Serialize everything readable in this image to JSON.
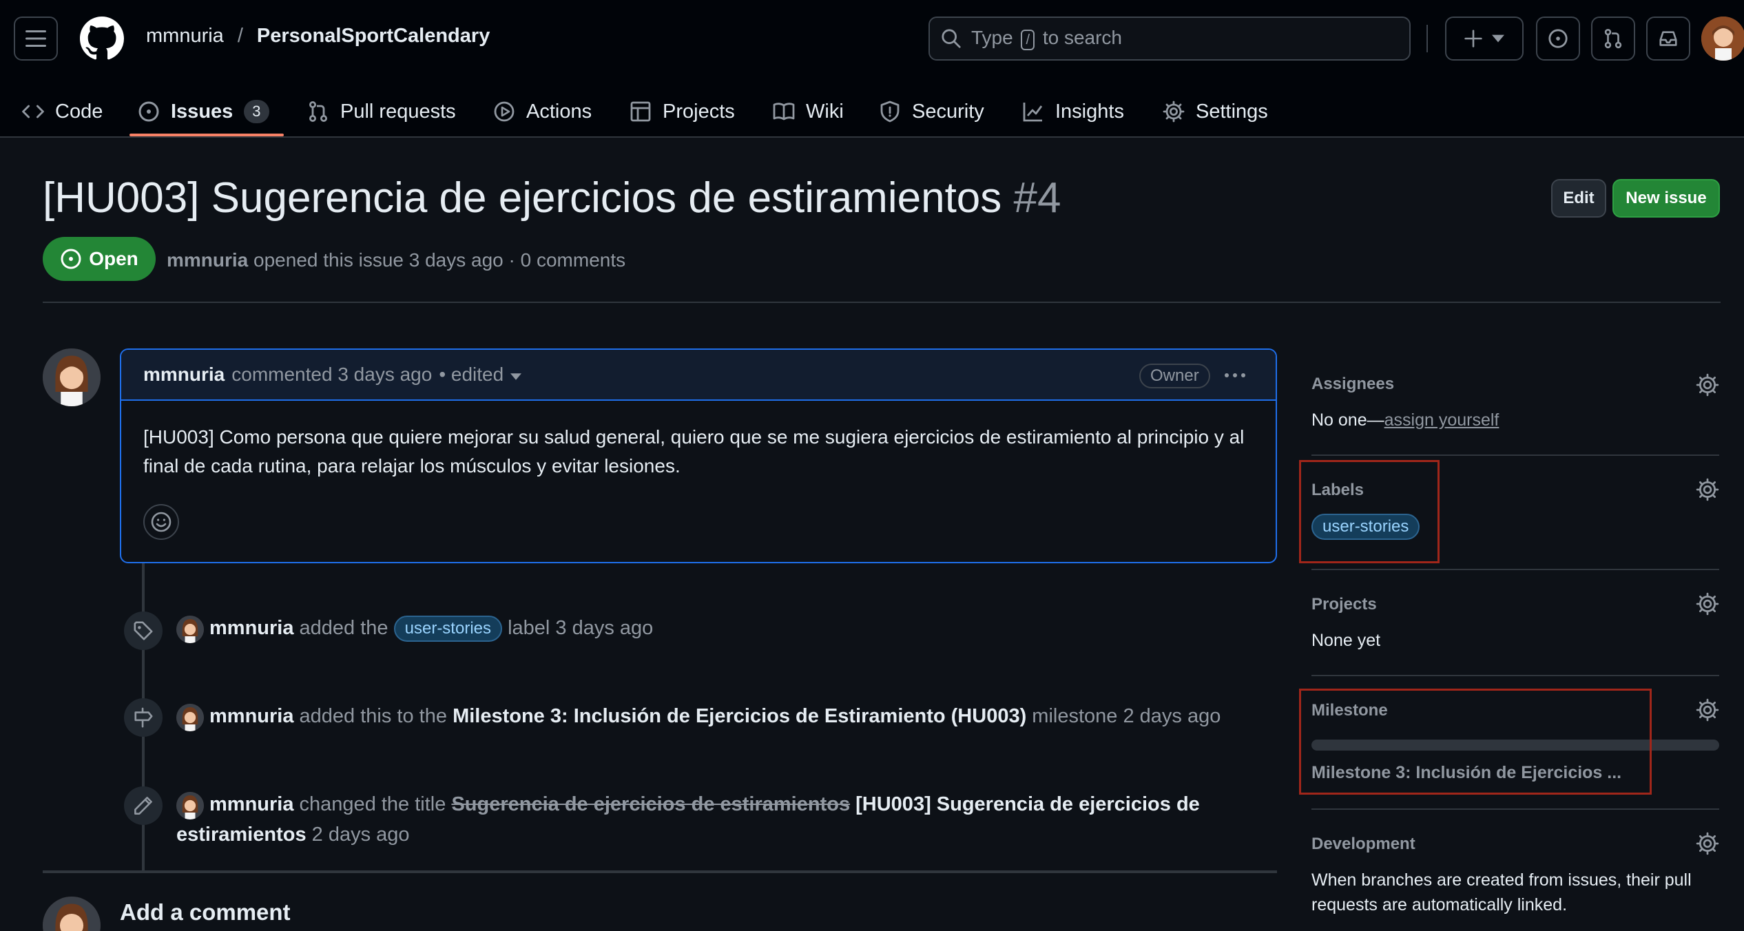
{
  "header": {
    "owner": "mmnuria",
    "separator": "/",
    "repo": "PersonalSportCalendary",
    "search_prefix": "Type",
    "search_key": "/",
    "search_suffix": "to search"
  },
  "tabs": [
    {
      "label": "Code",
      "icon": "code-icon"
    },
    {
      "label": "Issues",
      "icon": "issue-opened-icon",
      "count": "3"
    },
    {
      "label": "Pull requests",
      "icon": "git-pull-request-icon"
    },
    {
      "label": "Actions",
      "icon": "play-icon"
    },
    {
      "label": "Projects",
      "icon": "table-icon"
    },
    {
      "label": "Wiki",
      "icon": "book-icon"
    },
    {
      "label": "Security",
      "icon": "shield-icon"
    },
    {
      "label": "Insights",
      "icon": "graph-icon"
    },
    {
      "label": "Settings",
      "icon": "gear-icon"
    }
  ],
  "issue": {
    "title": "[HU003] Sugerencia de ejercicios de estiramientos",
    "number": "#4",
    "state": "Open",
    "author": "mmnuria",
    "meta_text": "opened this issue 3 days ago · 0 comments",
    "edit_label": "Edit",
    "new_issue_label": "New issue"
  },
  "comment": {
    "author": "mmnuria",
    "meta": "commented 3 days ago",
    "edited": "• edited",
    "role": "Owner",
    "body": "[HU003] Como persona que quiere mejorar su salud general, quiero que se me sugiera ejercicios de estiramiento al principio y al final de cada rutina, para relajar los músculos y evitar lesiones."
  },
  "timeline": [
    {
      "icon": "tag-icon",
      "actor": "mmnuria",
      "pre": "added the",
      "label": "user-stories",
      "post": "label 3 days ago"
    },
    {
      "icon": "milestone-icon",
      "actor": "mmnuria",
      "pre": "added this to the",
      "milestone": "Milestone 3: Inclusión de Ejercicios de Estiramiento (HU003)",
      "post": "milestone 2 days ago"
    },
    {
      "icon": "pencil-icon",
      "actor": "mmnuria",
      "pre": "changed the title",
      "old_title": "Sugerencia de ejercicios de estiramientos",
      "new_title_line1": "[HU003] Sugerencia de ejercicios de",
      "new_title_line2": "estiramientos",
      "post": "2 days ago"
    }
  ],
  "add_comment": "Add a comment",
  "sidebar": {
    "assignees": {
      "title": "Assignees",
      "text": "No one—",
      "link": "assign yourself"
    },
    "labels": {
      "title": "Labels",
      "label": "user-stories"
    },
    "projects": {
      "title": "Projects",
      "text": "None yet"
    },
    "milestone": {
      "title": "Milestone",
      "name": "Milestone 3: Inclusión de Ejercicios ...",
      "progress": 0
    },
    "development": {
      "title": "Development",
      "line1": "When branches are created from issues, their pull",
      "line2": "requests are automatically linked."
    }
  },
  "colors": {
    "accent_green": "#238636",
    "tab_underline": "#f78166",
    "highlight": "#a0261a"
  }
}
